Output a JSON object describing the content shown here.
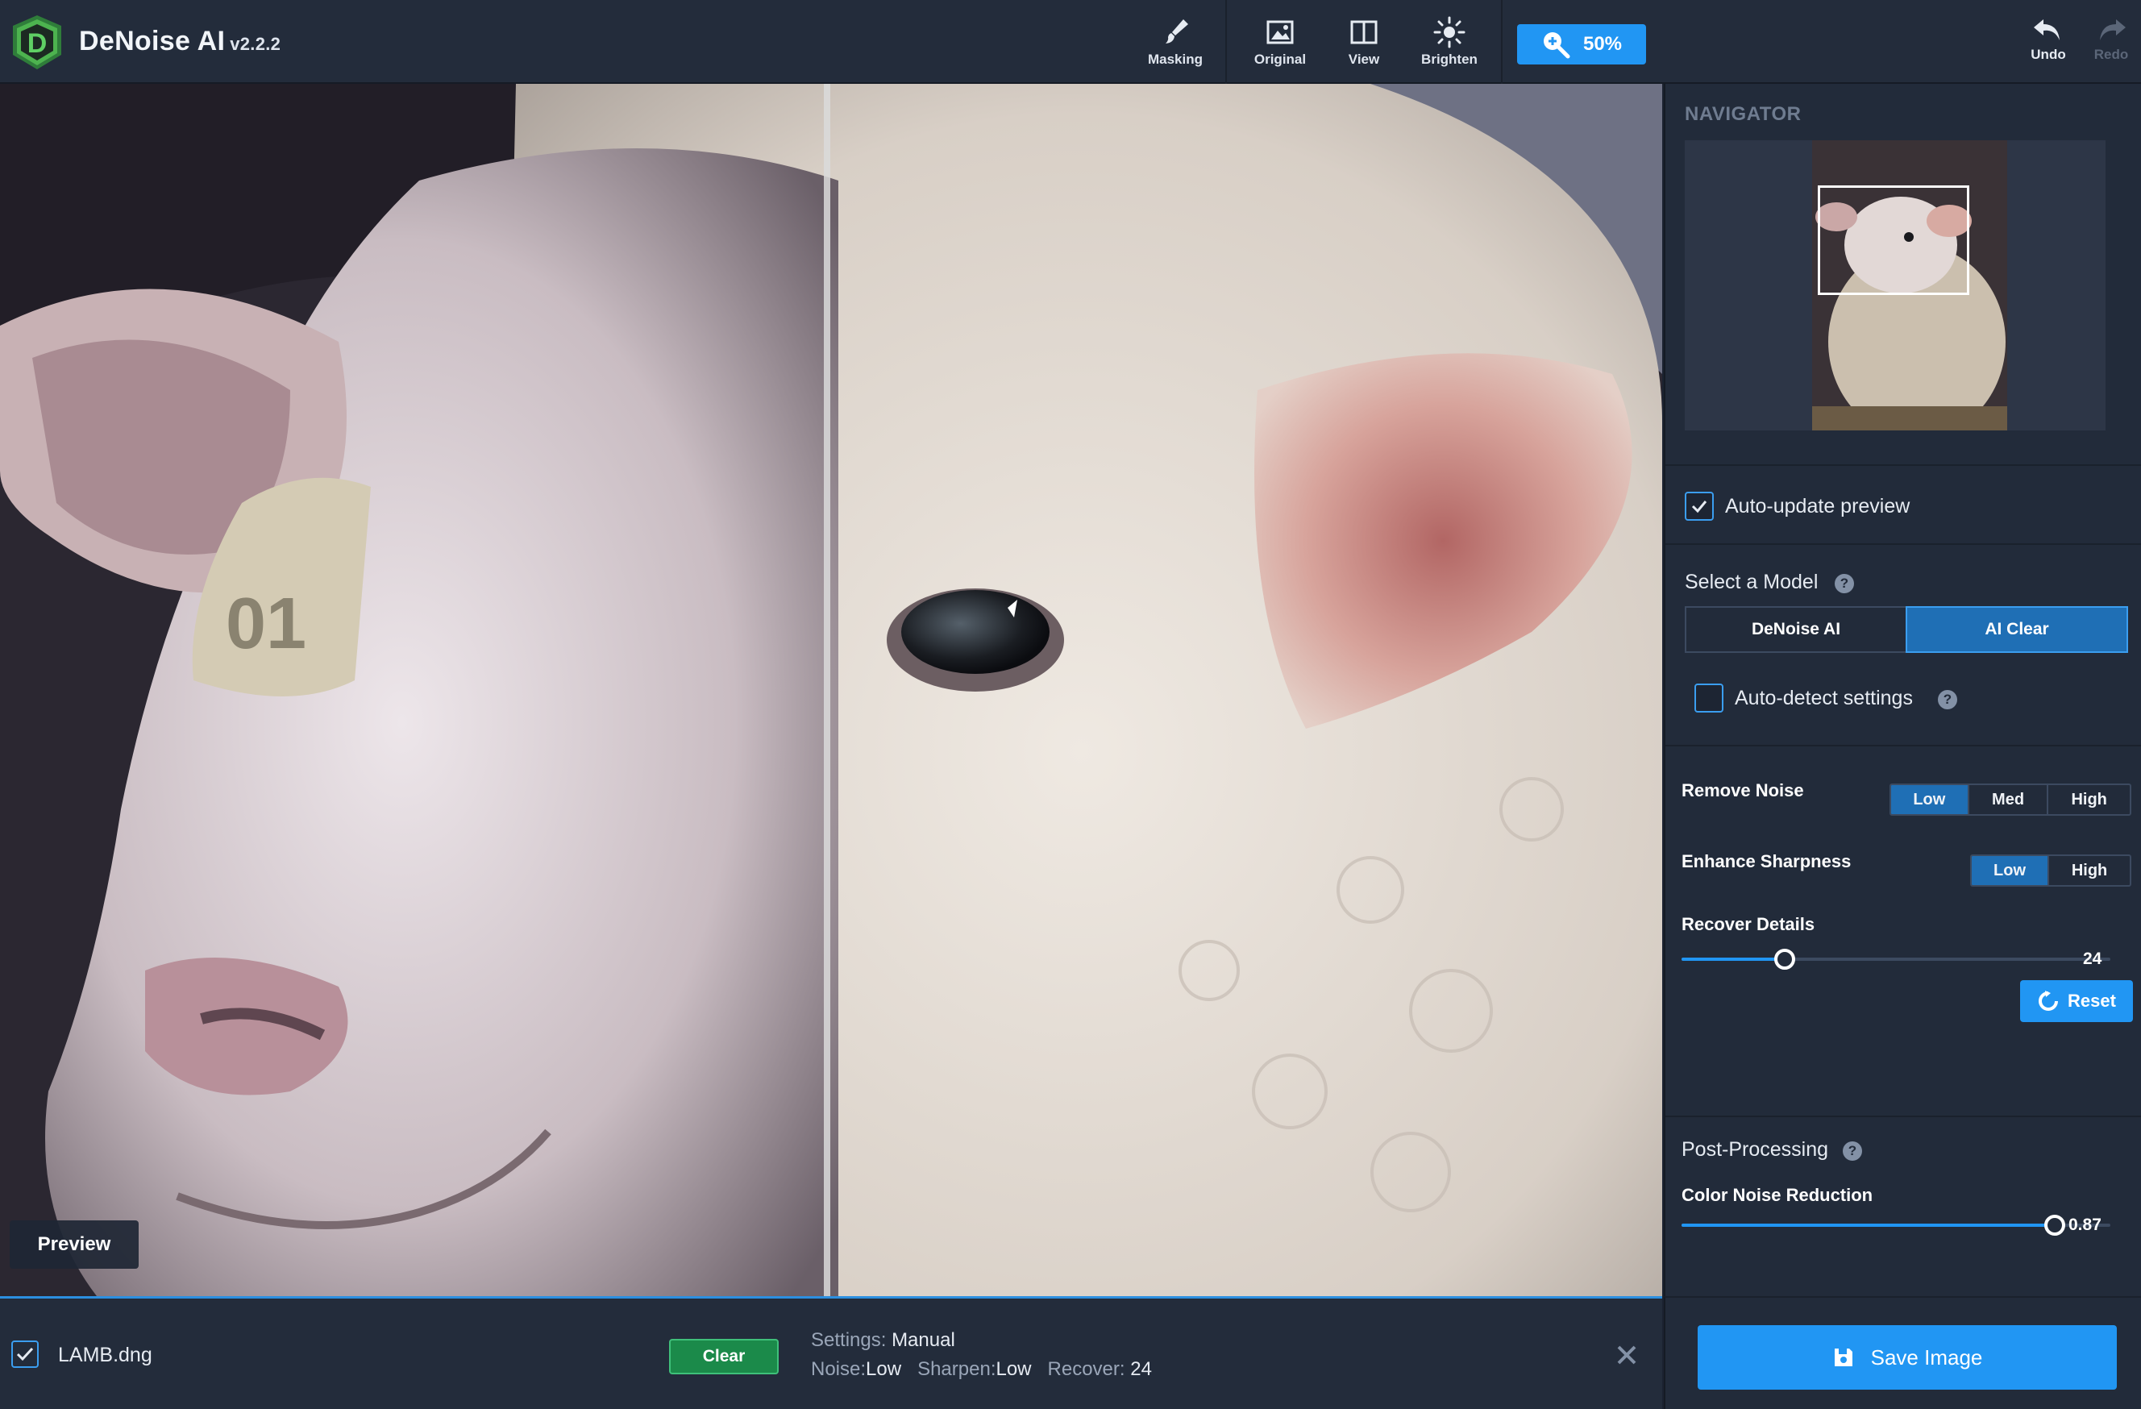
{
  "app": {
    "title": "DeNoise AI",
    "version": "v2.2.2"
  },
  "toolbar": {
    "masking": "Masking",
    "original": "Original",
    "view": "View",
    "brighten": "Brighten",
    "zoom": "50%",
    "undo": "Undo",
    "redo": "Redo"
  },
  "viewport": {
    "preview_label": "Preview"
  },
  "navigator": {
    "title": "NAVIGATOR"
  },
  "panel": {
    "auto_update_label": "Auto-update preview",
    "auto_update_checked": true,
    "select_model_label": "Select a Model",
    "models": [
      "DeNoise AI",
      "AI Clear"
    ],
    "active_model": "AI Clear",
    "auto_detect_label": "Auto-detect settings",
    "auto_detect_checked": false,
    "remove_noise": {
      "label": "Remove Noise",
      "options": [
        "Low",
        "Med",
        "High"
      ],
      "selected": "Low"
    },
    "enhance_sharpness": {
      "label": "Enhance Sharpness",
      "options": [
        "Low",
        "High"
      ],
      "selected": "Low"
    },
    "recover_details": {
      "label": "Recover Details",
      "value": "24",
      "fraction": 0.24
    },
    "reset_label": "Reset",
    "post_processing_label": "Post-Processing",
    "color_noise": {
      "label": "Color Noise Reduction",
      "value": "0.87",
      "fraction": 0.87
    }
  },
  "file": {
    "name": "LAMB.dng",
    "checked": true,
    "clear_label": "Clear",
    "settings_key": "Settings:",
    "settings_val": "Manual",
    "noise_key": "Noise:",
    "noise_val": "Low",
    "sharpen_key": "Sharpen:",
    "sharpen_val": "Low",
    "recover_key": "Recover:",
    "recover_val": "24"
  },
  "save": {
    "label": "Save Image"
  },
  "colors": {
    "accent": "#2196f3",
    "clear_green": "#1b8a4a",
    "panel_bg": "#222b3a"
  },
  "icons": [
    "logo-icon",
    "brush-icon",
    "image-icon",
    "split-view-icon",
    "sun-icon",
    "zoom-icon",
    "undo-icon",
    "redo-icon",
    "help-icon",
    "check-icon",
    "reset-icon",
    "close-icon",
    "save-icon"
  ]
}
